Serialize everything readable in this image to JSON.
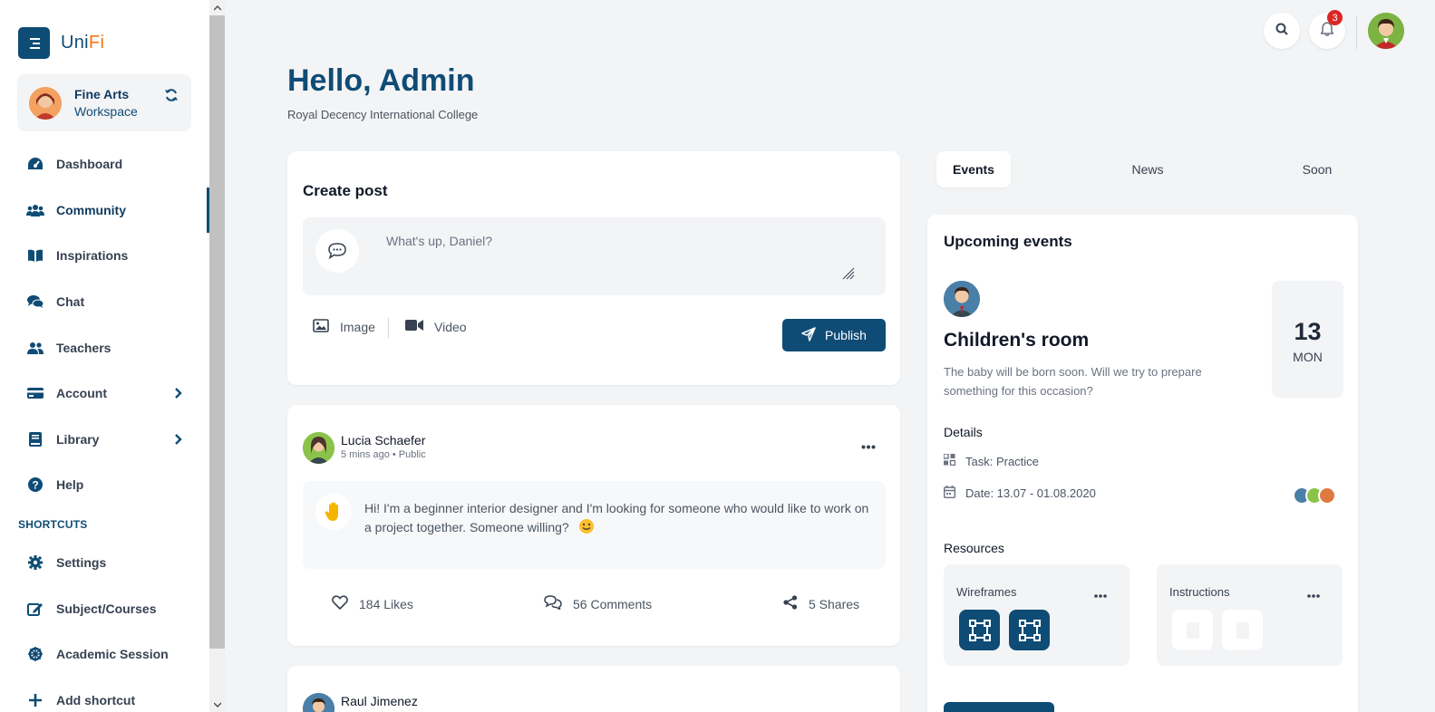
{
  "app": {
    "logo_prefix": "Uni",
    "logo_suffix": "Fi",
    "accent_color": "#0f4c75",
    "logo_accent": "#f97316"
  },
  "workspace": {
    "name": "Fine Arts",
    "subtitle": "Workspace"
  },
  "sidebar": {
    "items": [
      {
        "label": "Dashboard",
        "icon": "speedometer-icon"
      },
      {
        "label": "Community",
        "icon": "users-icon",
        "active": true
      },
      {
        "label": "Inspirations",
        "icon": "book-icon"
      },
      {
        "label": "Chat",
        "icon": "chat-icon"
      },
      {
        "label": "Teachers",
        "icon": "users-icon"
      },
      {
        "label": "Account",
        "icon": "card-icon",
        "expandable": true
      },
      {
        "label": "Library",
        "icon": "library-icon",
        "expandable": true
      },
      {
        "label": "Help",
        "icon": "help-icon"
      }
    ],
    "shortcuts_title": "SHORTCUTS",
    "shortcuts": [
      {
        "label": "Settings",
        "icon": "gear-icon"
      },
      {
        "label": "Subject/Courses",
        "icon": "edit-icon"
      },
      {
        "label": "Academic Session",
        "icon": "wheel-icon"
      },
      {
        "label": "Add shortcut",
        "icon": "plus-icon"
      }
    ]
  },
  "header": {
    "notification_count": "3"
  },
  "main": {
    "greeting": "Hello, Admin",
    "organization": "Royal Decency International College"
  },
  "create_post": {
    "title": "Create post",
    "placeholder": "What's up, Daniel?",
    "image_label": "Image",
    "video_label": "Video",
    "publish_label": "Publish"
  },
  "posts": [
    {
      "author": "Lucia Schaefer",
      "time": "5 mins ago",
      "visibility": "Public",
      "text": "Hi! I'm a beginner interior designer and I'm looking for someone who would like to work on a project together. Someone willing?",
      "likes": "184 Likes",
      "comments": "56 Comments",
      "shares": "5 Shares"
    },
    {
      "author": "Raul Jimenez"
    }
  ],
  "tabs": [
    {
      "label": "Events",
      "active": true
    },
    {
      "label": "News"
    },
    {
      "label": "Soon"
    }
  ],
  "events": {
    "title": "Upcoming events",
    "event_name": "Children's room",
    "description": "The baby will be born soon. Will we try to prepare something for this occasion?",
    "day": "13",
    "weekday": "MON",
    "details_label": "Details",
    "task": "Task: Practice",
    "date_range": "Date: 13.07 - 01.08.2020",
    "resources_label": "Resources",
    "resources": [
      {
        "name": "Wireframes"
      },
      {
        "name": "Instructions"
      }
    ]
  }
}
